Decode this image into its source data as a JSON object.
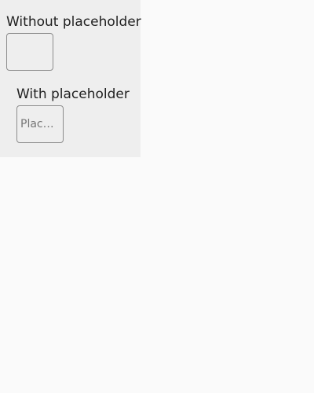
{
  "without": {
    "label": "Without placeholder",
    "value": ""
  },
  "with": {
    "label": "With placeholder",
    "placeholder": "Placeholder",
    "value": ""
  }
}
